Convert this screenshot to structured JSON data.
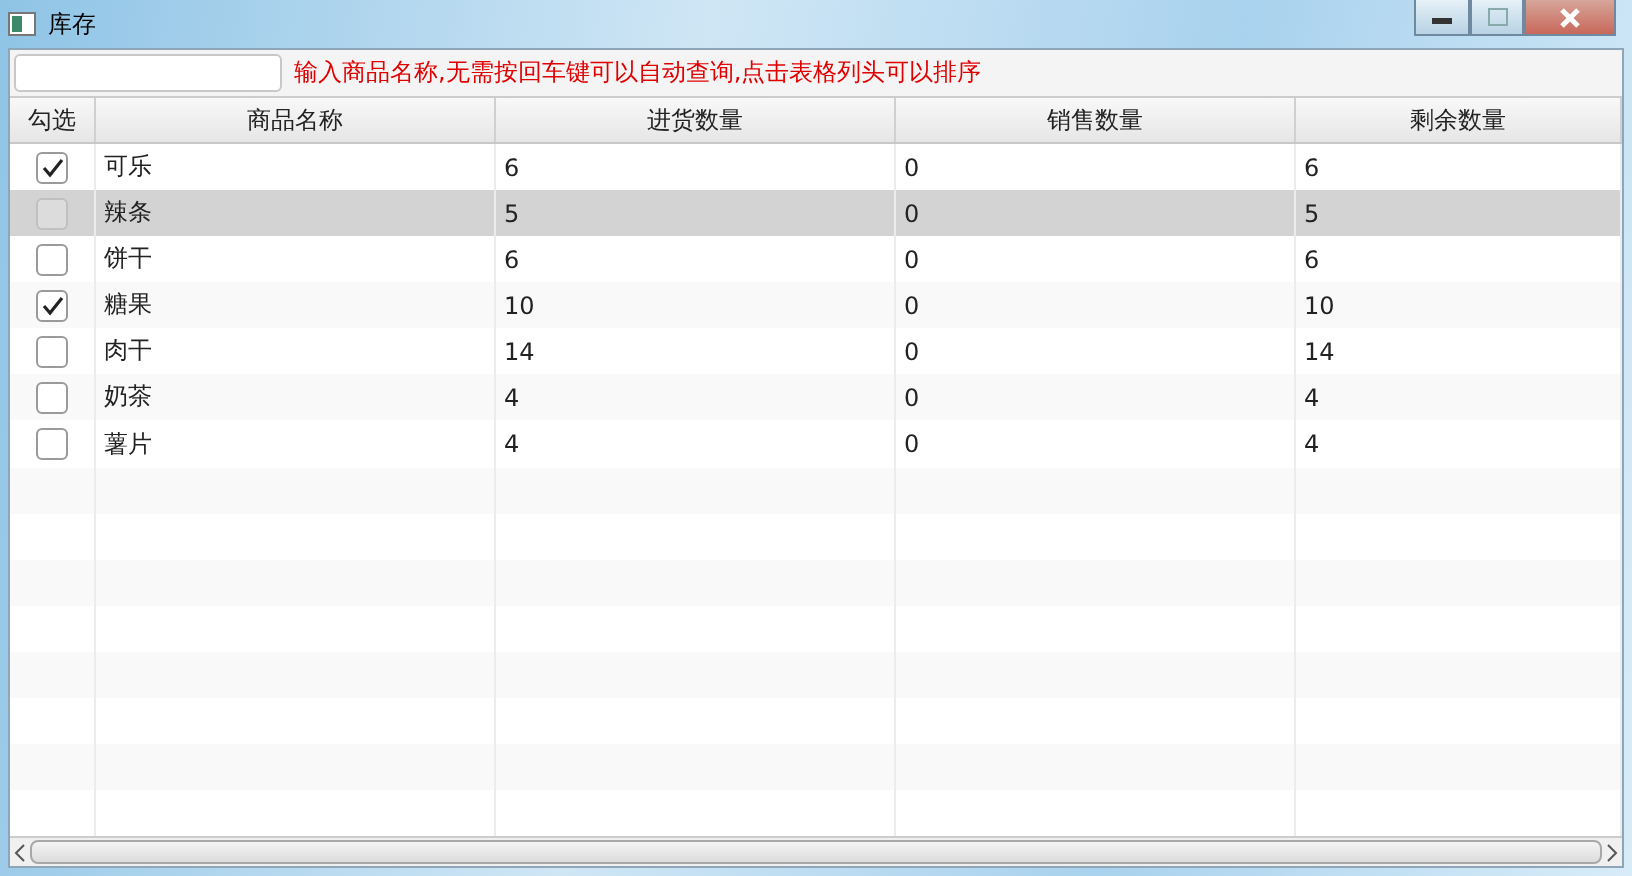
{
  "window": {
    "title": "库存"
  },
  "search": {
    "hint": "输入商品名称,无需按回车键可以自动查询,点击表格列头可以排序"
  },
  "table": {
    "columns": [
      "勾选",
      "商品名称",
      "进货数量",
      "销售数量",
      "剩余数量"
    ],
    "rows": [
      {
        "checked": true,
        "selected": false,
        "cells": [
          "可乐",
          "6",
          "0",
          "6"
        ]
      },
      {
        "checked": false,
        "selected": true,
        "cells": [
          "辣条",
          "5",
          "0",
          "5"
        ]
      },
      {
        "checked": false,
        "selected": false,
        "cells": [
          "饼干",
          "6",
          "0",
          "6"
        ]
      },
      {
        "checked": true,
        "selected": false,
        "cells": [
          "糖果",
          "10",
          "0",
          "10"
        ]
      },
      {
        "checked": false,
        "selected": false,
        "cells": [
          "肉干",
          "14",
          "0",
          "14"
        ]
      },
      {
        "checked": false,
        "selected": false,
        "cells": [
          "奶茶",
          "4",
          "0",
          "4"
        ]
      },
      {
        "checked": false,
        "selected": false,
        "cells": [
          "薯片",
          "4",
          "0",
          "4"
        ]
      }
    ]
  }
}
